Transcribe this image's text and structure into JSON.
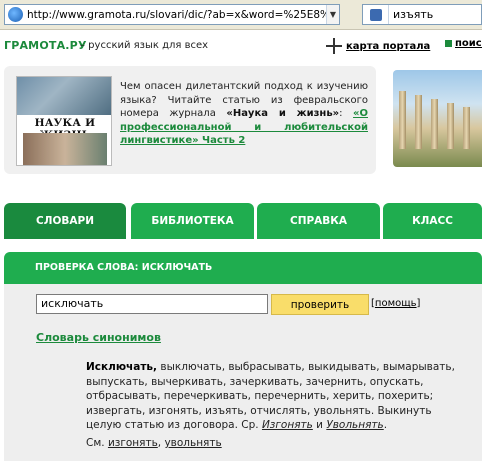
{
  "browser": {
    "url": "http://www.gramota.ru/slovari/dic/?ab=x&word=%25E8%",
    "search_query": "изъять"
  },
  "site": {
    "logo": "ГРАМОТА.РУ",
    "tagline": "– русский язык для всех",
    "portal_map": "карта портала",
    "search_link": "поиск"
  },
  "banner": {
    "magazine_title": "НАУКА И ЖИЗНЬ",
    "text_intro": "Чем опасен дилетантский подход к изучению языка? Читайте статью из февральского номера журнала ",
    "journal": "«Наука и жизнь»",
    "colon": ": ",
    "article_link": "«О профессиональной и любительской лингвистике» Часть 2"
  },
  "nav": {
    "tabs": [
      "СЛОВАРИ",
      "БИБЛИОТЕКА",
      "СПРАВКА",
      "КЛАСС"
    ]
  },
  "section": {
    "title": "ПРОВЕРКА СЛОВА: ИСКЛЮЧАТЬ"
  },
  "form": {
    "input_value": "исключать",
    "check_button": "проверить",
    "help_open": "[",
    "help_link": "помощь",
    "help_close": "]"
  },
  "dictionary": {
    "name": "Словарь синонимов",
    "headword": "Исключать,",
    "body": " выключать, выбрасывать, выкидывать, вымарывать, выпускать, вычеркивать, зачеркивать, зачернить, опускать, отбрасывать, перечеркивать, перечернить, херить, похерить; извергать, изгонять, изъять, отчислять, увольнять. Выкинуть целую статью из договора. Ср. ",
    "ref1": "Изгонять",
    "and": " и ",
    "ref2": "Увольнять",
    "end": ".",
    "see_label": "См. ",
    "see1": "изгонять",
    "see_sep": ", ",
    "see2": "увольнять"
  }
}
